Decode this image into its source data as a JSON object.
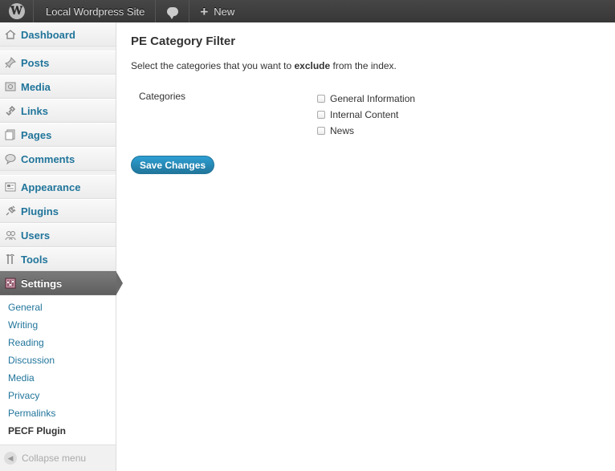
{
  "adminbar": {
    "site_name": "Local Wordpress Site",
    "new_label": "New"
  },
  "sidebar": {
    "items": [
      {
        "label": "Dashboard",
        "icon": "dashboard-icon"
      },
      {
        "label": "Posts",
        "icon": "pushpin-icon"
      },
      {
        "label": "Media",
        "icon": "media-icon"
      },
      {
        "label": "Links",
        "icon": "links-icon"
      },
      {
        "label": "Pages",
        "icon": "pages-icon"
      },
      {
        "label": "Comments",
        "icon": "comments-icon"
      },
      {
        "label": "Appearance",
        "icon": "appearance-icon"
      },
      {
        "label": "Plugins",
        "icon": "plugins-icon"
      },
      {
        "label": "Users",
        "icon": "users-icon"
      },
      {
        "label": "Tools",
        "icon": "tools-icon"
      },
      {
        "label": "Settings",
        "icon": "settings-icon"
      }
    ],
    "submenu": [
      "General",
      "Writing",
      "Reading",
      "Discussion",
      "Media",
      "Privacy",
      "Permalinks",
      "PECF Plugin"
    ],
    "collapse_label": "Collapse menu"
  },
  "main": {
    "title": "PE Category Filter",
    "desc_before": "Select the categories that you want to ",
    "desc_bold": "exclude",
    "desc_after": " from the index.",
    "categories_label": "Categories",
    "categories": [
      "General Information",
      "Internal Content",
      "News"
    ],
    "save_label": "Save Changes"
  },
  "colors": {
    "link": "#21759b",
    "adminbar": "#464646",
    "active_menu": "#6d6d6d",
    "button": "#21759b"
  }
}
